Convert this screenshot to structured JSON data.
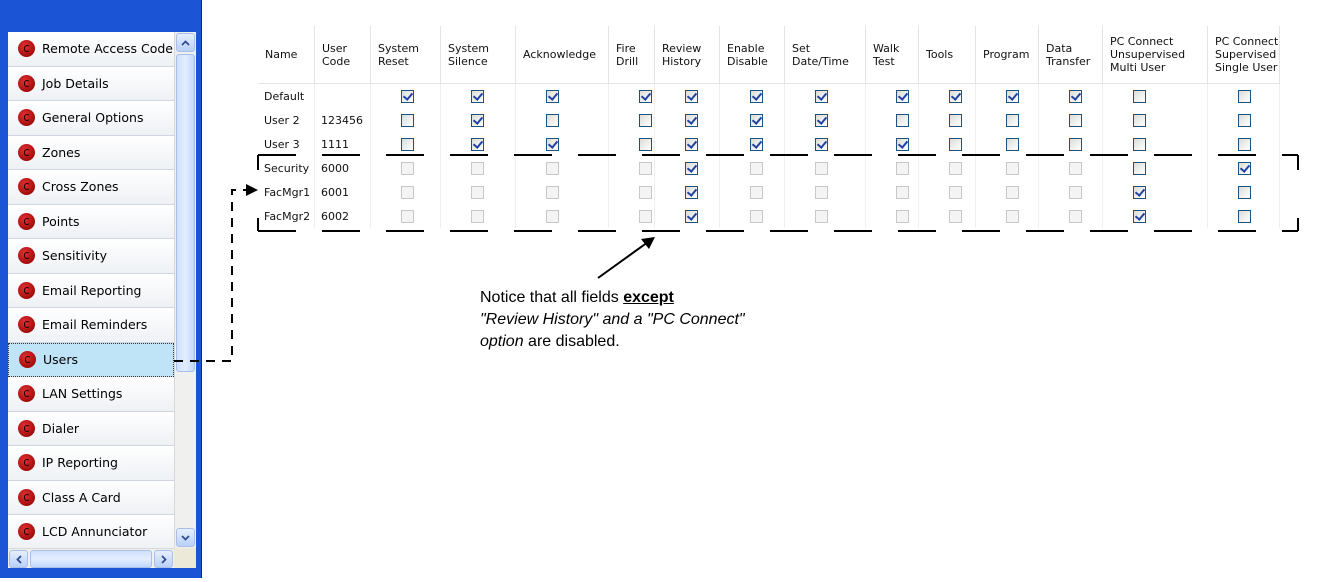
{
  "sidebar": {
    "items": [
      {
        "label": "Remote Access Code",
        "icon": "red-circle-icon",
        "selected": false
      },
      {
        "label": "Job Details",
        "icon": "red-circle-icon",
        "selected": false
      },
      {
        "label": "General Options",
        "icon": "red-circle-icon",
        "selected": false
      },
      {
        "label": "Zones",
        "icon": "red-circle-icon",
        "selected": false
      },
      {
        "label": "Cross Zones",
        "icon": "red-circle-icon",
        "selected": false
      },
      {
        "label": "Points",
        "icon": "red-circle-icon",
        "selected": false
      },
      {
        "label": "Sensitivity",
        "icon": "red-circle-icon",
        "selected": false
      },
      {
        "label": "Email Reporting",
        "icon": "red-circle-icon",
        "selected": false
      },
      {
        "label": "Email Reminders",
        "icon": "red-circle-icon",
        "selected": false
      },
      {
        "label": "Users",
        "icon": "red-circle-icon",
        "selected": true
      },
      {
        "label": "LAN Settings",
        "icon": "red-circle-icon",
        "selected": false
      },
      {
        "label": "Dialer",
        "icon": "red-circle-icon",
        "selected": false
      },
      {
        "label": "IP Reporting",
        "icon": "red-circle-icon",
        "selected": false
      },
      {
        "label": "Class A Card",
        "icon": "red-circle-icon",
        "selected": false
      },
      {
        "label": "LCD Annunciator",
        "icon": "red-circle-icon",
        "selected": false
      }
    ]
  },
  "grid": {
    "columns": [
      "Name",
      "User\nCode",
      "System\nReset",
      "System\nSilence",
      "Acknowledge",
      "Fire\nDrill",
      "Review\nHistory",
      "Enable\nDisable",
      "Set\nDate/Time",
      "Walk\nTest",
      "Tools",
      "Program",
      "Data\nTransfer",
      "PC Connect\nUnsupervised\nMulti User",
      "PC Connect\nSupervised\nSingle User"
    ],
    "rows": [
      {
        "name": "Default",
        "code": "",
        "enabled": [
          1,
          1,
          1,
          1,
          1,
          1,
          1,
          1,
          1,
          1,
          1,
          1,
          1
        ],
        "checked": [
          1,
          1,
          1,
          1,
          1,
          1,
          1,
          1,
          1,
          1,
          1,
          0,
          0
        ]
      },
      {
        "name": "User 2",
        "code": "123456",
        "enabled": [
          1,
          1,
          1,
          1,
          1,
          1,
          1,
          1,
          1,
          1,
          1,
          1,
          1
        ],
        "checked": [
          0,
          1,
          0,
          0,
          1,
          1,
          1,
          0,
          0,
          0,
          0,
          0,
          0
        ]
      },
      {
        "name": "User 3",
        "code": "1111",
        "enabled": [
          1,
          1,
          1,
          1,
          1,
          1,
          1,
          1,
          1,
          1,
          1,
          1,
          1
        ],
        "checked": [
          0,
          1,
          1,
          0,
          1,
          1,
          1,
          1,
          0,
          0,
          0,
          0,
          0
        ]
      },
      {
        "name": "Security",
        "code": "6000",
        "enabled": [
          0,
          0,
          0,
          0,
          1,
          0,
          0,
          0,
          0,
          0,
          0,
          1,
          1
        ],
        "checked": [
          0,
          0,
          0,
          0,
          1,
          0,
          0,
          0,
          0,
          0,
          0,
          0,
          1
        ]
      },
      {
        "name": "FacMgr1",
        "code": "6001",
        "enabled": [
          0,
          0,
          0,
          0,
          1,
          0,
          0,
          0,
          0,
          0,
          0,
          1,
          1
        ],
        "checked": [
          0,
          0,
          0,
          0,
          1,
          0,
          0,
          0,
          0,
          0,
          0,
          1,
          0
        ]
      },
      {
        "name": "FacMgr2",
        "code": "6002",
        "enabled": [
          0,
          0,
          0,
          0,
          1,
          0,
          0,
          0,
          0,
          0,
          0,
          1,
          1
        ],
        "checked": [
          0,
          0,
          0,
          0,
          1,
          0,
          0,
          0,
          0,
          0,
          0,
          1,
          0
        ]
      }
    ]
  },
  "annotation": {
    "part1": "Notice that all fields ",
    "part2": "except",
    "part3": "\"Review History\" and a \"PC Connect\" option",
    "part4": " are disabled."
  },
  "colors": {
    "frame": "#1c54d6",
    "selected_bg": "#bfe3f7",
    "check": "#2142a8",
    "enabled_border": "#1c5180",
    "disabled_border": "#c8c8c8"
  }
}
